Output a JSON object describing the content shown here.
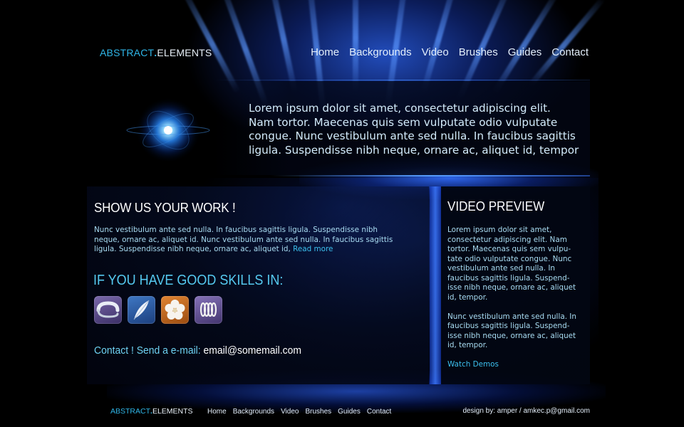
{
  "brand": {
    "part1": "ABSTRACT",
    "dot": ".",
    "part2": "ELEMENTS"
  },
  "nav": [
    "Home",
    "Backgrounds",
    "Video",
    "Brushes",
    "Guides",
    "Contact"
  ],
  "hero": {
    "lines": [
      "Lorem ipsum dolor sit amet, consectetur adipiscing elit.",
      "Nam tortor. Maecenas quis sem vulputate odio vulputate",
      "congue. Nunc vestibulum ante sed nulla. In faucibus sagittis",
      "ligula. Suspendisse nibh neque, ornare ac, aliquet id, tempor"
    ]
  },
  "show_work": {
    "title": "SHOW US YOUR WORK !",
    "lines": [
      "Nunc vestibulum ante sed nulla. In faucibus sagittis ligula. Suspendisse nibh",
      "neque, ornare ac, aliquet id. Nunc vestibulum ante sed nulla. In faucibus sagittis",
      "ligula. Suspendisse nibh neque, ornare ac, aliquet id,"
    ],
    "read_more": "Read more"
  },
  "skills": {
    "title": "IF YOU HAVE GOOD SKILLS IN:",
    "icons": [
      "horseshoe-icon",
      "feather-icon",
      "flower-icon",
      "spring-coil-icon"
    ],
    "colors": [
      "#5e4d8c",
      "#2f5fa8",
      "#c86a1e",
      "#6a56a0"
    ]
  },
  "contact": {
    "label": "Contact ! Send a e-mail:",
    "email": "email@somemail.com"
  },
  "video_preview": {
    "title": "VIDEO PREVIEW",
    "para1": [
      "Lorem ipsum dolor sit amet,",
      "consectetur adipiscing elit. Nam",
      "tortor. Maecenas quis sem vulpu-",
      "tate odio vulputate congue. Nunc",
      "vestibulum ante sed nulla. In",
      "faucibus sagittis ligula. Suspend-",
      "isse nibh neque, ornare ac, aliquet",
      "id, tempor."
    ],
    "para2": [
      "Nunc vestibulum ante sed nulla. In",
      "faucibus sagittis ligula. Suspend-",
      "isse nibh neque, ornare ac, aliquet",
      "id, tempor."
    ],
    "watch_link": "Watch Demos"
  },
  "footer": {
    "nav": [
      "Home",
      "Backgrounds",
      "Video",
      "Brushes",
      "Guides",
      "Contact"
    ],
    "credit": "design by: amper / amkec.p@gmail.com"
  }
}
